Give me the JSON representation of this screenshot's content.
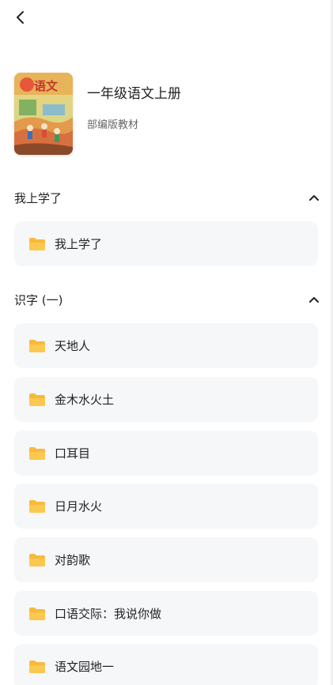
{
  "header": {
    "back_icon": "chevron-left-icon"
  },
  "book": {
    "title": "一年级语文上册",
    "subtitle": "部编版教材",
    "cover_title": "语文"
  },
  "sections": [
    {
      "title": "我上学了",
      "items": [
        "我上学了"
      ]
    },
    {
      "title": "识字 (一)",
      "items": [
        "天地人",
        "金木水火土",
        "口耳目",
        "日月水火",
        "对韵歌",
        "口语交际：我说你做",
        "语文园地一"
      ]
    }
  ],
  "colors": {
    "folder": "#f9b93b",
    "item_bg": "#f6f7f9"
  }
}
